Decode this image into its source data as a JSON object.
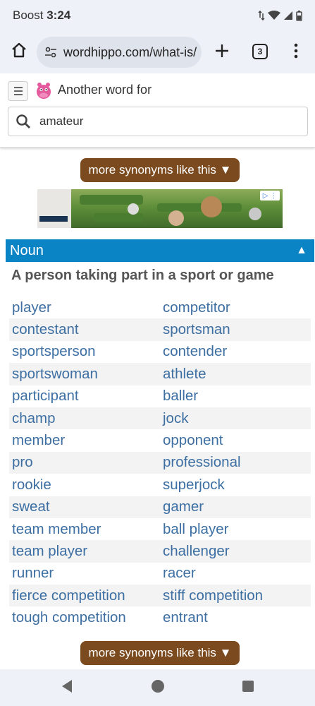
{
  "status_bar": {
    "carrier": "Boost",
    "time": "3:24"
  },
  "browser": {
    "url": "wordhippo.com/what-is/",
    "tab_count": "3"
  },
  "site": {
    "header_title": "Another word for",
    "search_value": "amateur"
  },
  "more_button_label": "more synonyms like this ▼",
  "section": {
    "part_of_speech": "Noun",
    "collapse_arrow": "▲",
    "sense_title": "A person taking part in a sport or game"
  },
  "synonyms": [
    [
      "player",
      "competitor"
    ],
    [
      "contestant",
      "sportsman"
    ],
    [
      "sportsperson",
      "contender"
    ],
    [
      "sportswoman",
      "athlete"
    ],
    [
      "participant",
      "baller"
    ],
    [
      "champ",
      "jock"
    ],
    [
      "member",
      "opponent"
    ],
    [
      "pro",
      "professional"
    ],
    [
      "rookie",
      "superjock"
    ],
    [
      "sweat",
      "gamer"
    ],
    [
      "team member",
      "ball player"
    ],
    [
      "team player",
      "challenger"
    ],
    [
      "runner",
      "racer"
    ],
    [
      "fierce competition",
      "stiff competition"
    ],
    [
      "tough competition",
      "entrant"
    ]
  ],
  "colors": {
    "accent_blue": "#0b84c6",
    "button_brown": "#7b4a1f",
    "link_blue": "#3d6fa3"
  }
}
